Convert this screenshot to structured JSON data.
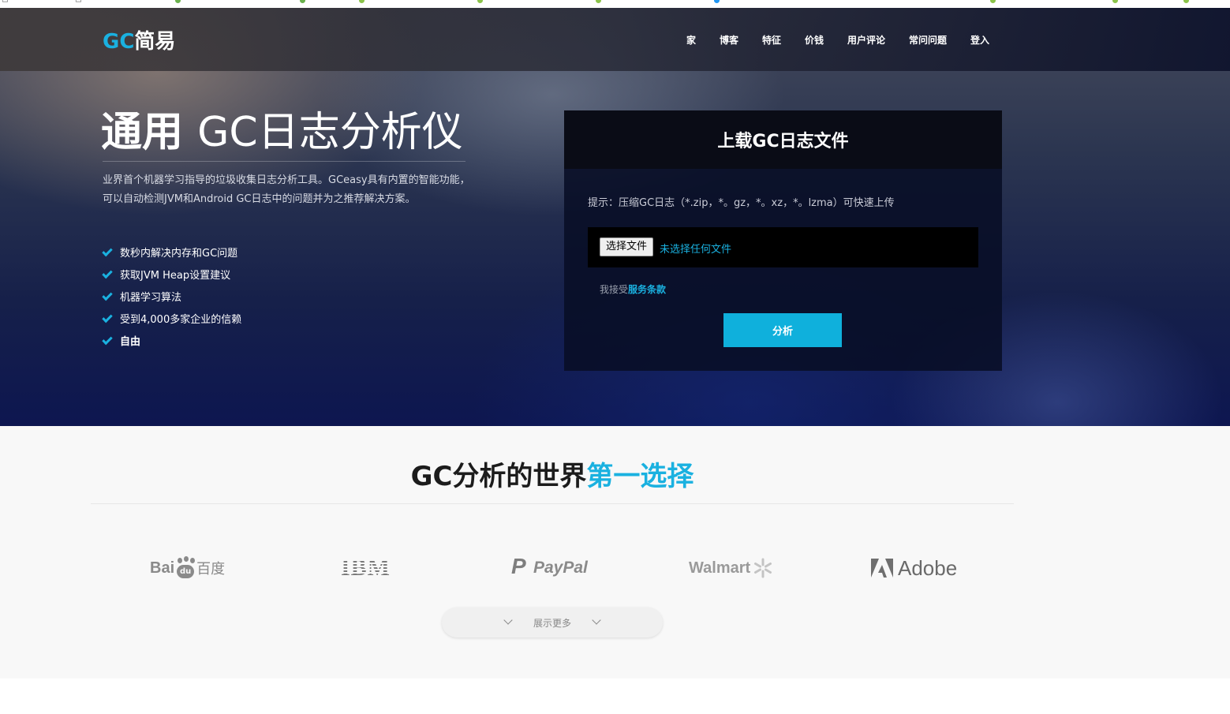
{
  "navbar": {
    "logo_gc": "GC",
    "logo_cn": "简易",
    "items": [
      "家",
      "博客",
      "特征",
      "价钱",
      "用户评论",
      "常问问题",
      "登入"
    ]
  },
  "hero": {
    "title_strong": "通用",
    "title_light": "GC日志分析仪",
    "description": "业界首个机器学习指导的垃圾收集日志分析工具。GCeasy具有内置的智能功能，可以自动检测JVM和Android GC日志中的问题并为之推荐解决方案。",
    "features": [
      "数秒内解决内存和GC问题",
      "获取JVM Heap设置建议",
      "机器学习算法",
      "受到4,000多家企业的信赖",
      "自由"
    ]
  },
  "upload": {
    "title": "上载GC日志文件",
    "hint": "提示：压缩GC日志（*.zip，*。gz，*。xz，*。lzma）可快速上传",
    "file_button": "选择文件",
    "file_status": "未选择任何文件",
    "terms_prefix": "我接受",
    "terms_link": "服务条款",
    "analyze_button": "分析"
  },
  "clients": {
    "title_main": "GC分析的世界",
    "title_highlight": "第一选择",
    "logos": {
      "baidu_latin": "Bai",
      "baidu_cn": "百度",
      "baidu_paw": "du",
      "ibm": "IBM",
      "paypal": "PayPal",
      "walmart": "Walmart",
      "adobe": "Adobe"
    },
    "show_more": "展示更多"
  },
  "colors": {
    "accent": "#1ab1e0",
    "button": "#0fb0dc"
  }
}
